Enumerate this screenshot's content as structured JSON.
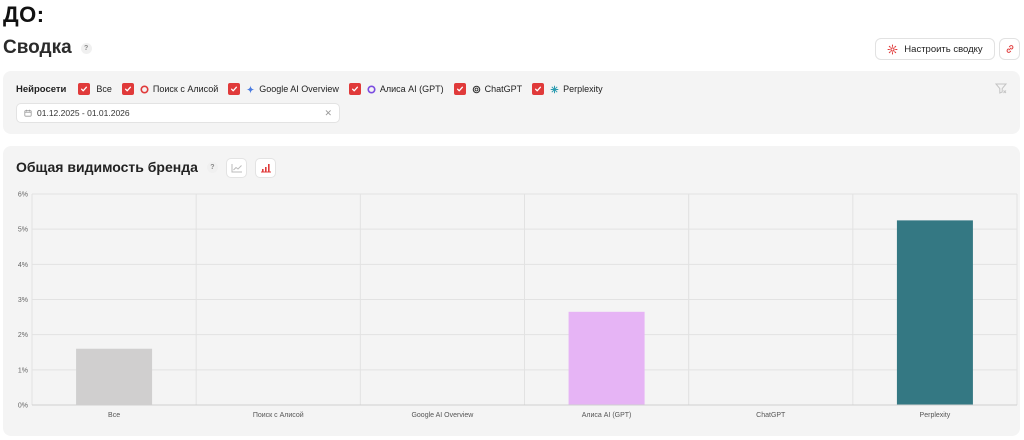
{
  "header": {
    "top_label": "ДО:",
    "title": "Сводка",
    "help": "?"
  },
  "toolbar": {
    "customize_label": "Настроить сводку"
  },
  "filters": {
    "label": "Нейросети",
    "items": [
      {
        "label": "Все",
        "checked": true,
        "icon": "none"
      },
      {
        "label": "Поиск с Алисой",
        "checked": true,
        "icon": "alice-ring-icon"
      },
      {
        "label": "Google AI Overview",
        "checked": true,
        "icon": "sparkle-icon"
      },
      {
        "label": "Алиса AI (GPT)",
        "checked": true,
        "icon": "alice-ai-ring-icon"
      },
      {
        "label": "ChatGPT",
        "checked": true,
        "icon": "chatgpt-icon"
      },
      {
        "label": "Perplexity",
        "checked": true,
        "icon": "perplexity-icon"
      }
    ],
    "date_range": "01.12.2025 - 01.01.2026"
  },
  "chart_section": {
    "title": "Общая видимость бренда",
    "help": "?"
  },
  "chart_data": {
    "type": "bar",
    "categories": [
      "Все",
      "Поиск с Алисой",
      "Google AI Overview",
      "Алиса AI (GPT)",
      "ChatGPT",
      "Perplexity"
    ],
    "values": [
      1.6,
      0,
      0,
      2.65,
      0,
      5.25
    ],
    "colors": [
      "#d0cfcf",
      "#d0cfcf",
      "#d0cfcf",
      "#e6b4f5",
      "#d0cfcf",
      "#347883"
    ],
    "ylim": [
      0,
      6
    ],
    "yticks": [
      0,
      1,
      2,
      3,
      4,
      5,
      6
    ],
    "ytick_labels": [
      "0%",
      "1%",
      "2%",
      "3%",
      "4%",
      "5%",
      "6%"
    ],
    "grid": true,
    "title": "",
    "xlabel": "",
    "ylabel": ""
  }
}
